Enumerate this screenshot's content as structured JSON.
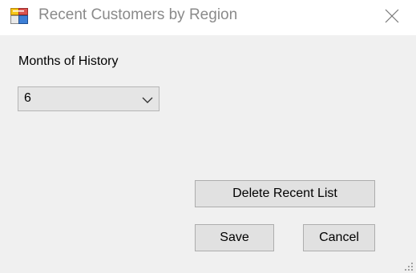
{
  "window": {
    "title": "Recent Customers by Region",
    "icon": "app-window-icon"
  },
  "form": {
    "months_label": "Months of History",
    "months_value": "6"
  },
  "buttons": {
    "delete_label": "Delete Recent List",
    "save_label": "Save",
    "cancel_label": "Cancel"
  },
  "icons": {
    "close": "close-icon",
    "dropdown": "chevron-down-icon",
    "resize": "resize-grip-icon"
  }
}
